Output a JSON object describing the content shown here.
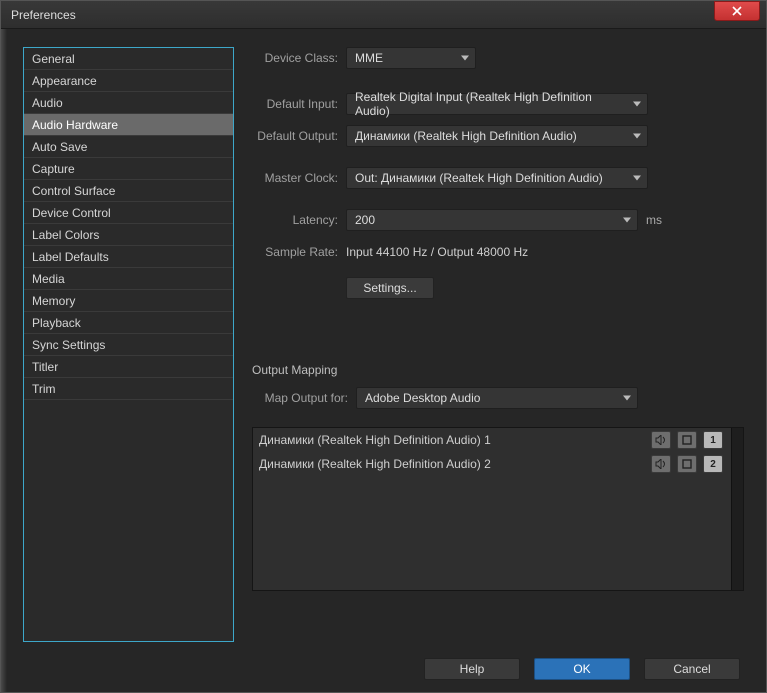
{
  "window": {
    "title": "Preferences"
  },
  "sidebar": {
    "items": [
      {
        "label": "General"
      },
      {
        "label": "Appearance"
      },
      {
        "label": "Audio"
      },
      {
        "label": "Audio Hardware"
      },
      {
        "label": "Auto Save"
      },
      {
        "label": "Capture"
      },
      {
        "label": "Control Surface"
      },
      {
        "label": "Device Control"
      },
      {
        "label": "Label Colors"
      },
      {
        "label": "Label Defaults"
      },
      {
        "label": "Media"
      },
      {
        "label": "Memory"
      },
      {
        "label": "Playback"
      },
      {
        "label": "Sync Settings"
      },
      {
        "label": "Titler"
      },
      {
        "label": "Trim"
      }
    ],
    "selected_index": 3
  },
  "form": {
    "device_class_label": "Device Class:",
    "device_class_value": "MME",
    "default_input_label": "Default Input:",
    "default_input_value": "Realtek Digital Input (Realtek High Definition Audio)",
    "default_output_label": "Default Output:",
    "default_output_value": "Динамики (Realtek High Definition Audio)",
    "master_clock_label": "Master Clock:",
    "master_clock_value": "Out: Динамики (Realtek High Definition Audio)",
    "latency_label": "Latency:",
    "latency_value": "200",
    "latency_unit": "ms",
    "sample_rate_label": "Sample Rate:",
    "sample_rate_value": "Input 44100 Hz / Output 48000 Hz",
    "settings_btn": "Settings..."
  },
  "output_mapping": {
    "section_title": "Output Mapping",
    "map_output_label": "Map Output for:",
    "map_output_value": "Adobe Desktop Audio",
    "rows": [
      {
        "name": "Динамики (Realtek High Definition Audio) 1",
        "channel": "1"
      },
      {
        "name": "Динамики (Realtek High Definition Audio) 2",
        "channel": "2"
      }
    ]
  },
  "footer": {
    "help": "Help",
    "ok": "OK",
    "cancel": "Cancel"
  }
}
